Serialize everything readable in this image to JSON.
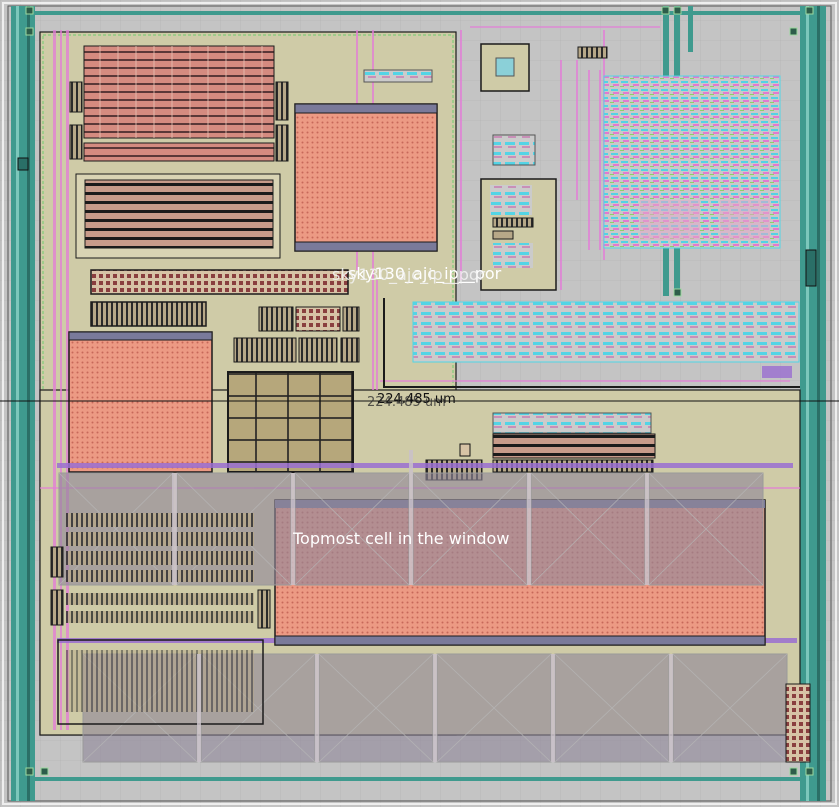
{
  "labels": {
    "top_cell": "sky130_ajc_ip__por",
    "window_cell": "Topmost cell in the window"
  },
  "measurement": {
    "distance": "224.485 um",
    "distance_overlap": "224.485 um"
  },
  "colors": {
    "background": "#c4c4c4",
    "border_teal": "#3f9a8e",
    "poly_salmon": "#e8957e",
    "metal_cyan": "#4fd6e6",
    "metal_magenta": "#e05cd6",
    "cell_overlay": "#9a8fa0",
    "diffusion_khaki": "#b9ad7c",
    "nwell_tan": "#cfc9a3"
  }
}
